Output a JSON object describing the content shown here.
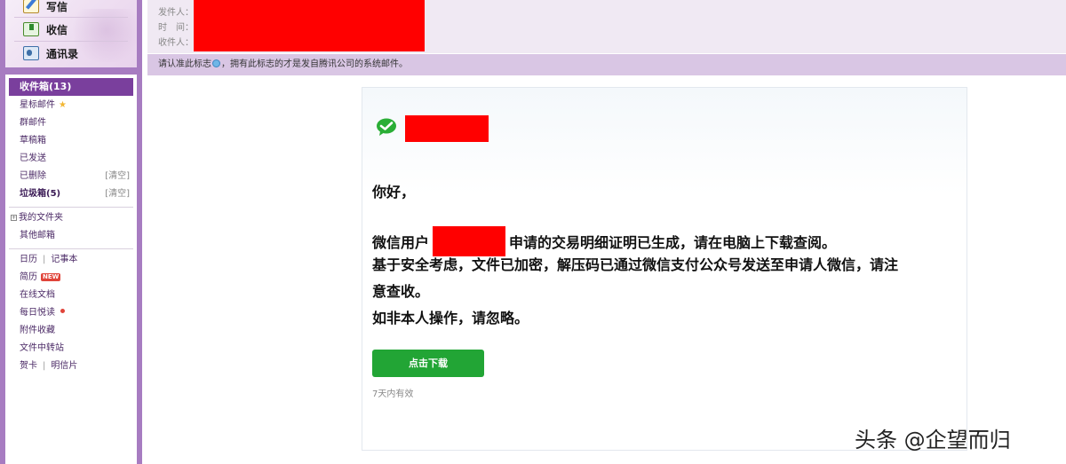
{
  "sidebar": {
    "quick_actions": [
      {
        "label": "写信",
        "icon": "compose-icon"
      },
      {
        "label": "收信",
        "icon": "receive-icon"
      },
      {
        "label": "通讯录",
        "icon": "contacts-icon"
      }
    ],
    "inbox_label": "收件箱(13)",
    "items": {
      "starred": "星标邮件",
      "group": "群邮件",
      "drafts": "草稿箱",
      "sent": "已发送",
      "deleted": "已删除",
      "deleted_action": "[清空]",
      "spam": "垃圾箱(5)",
      "spam_action": "[清空]",
      "my_folders": "我的文件夹",
      "other_mailbox": "其他邮箱",
      "calendar": "日历",
      "notebook": "记事本",
      "resume": "简历",
      "resume_badge": "NEW",
      "online_docs": "在线文档",
      "daily_read": "每日悦读",
      "attachments": "附件收藏",
      "file_transfer": "文件中转站",
      "greeting_card": "贺卡",
      "postcard": "明信片"
    }
  },
  "header": {
    "from_label": "发件人：",
    "time_label": "时　间：",
    "to_label": "收件人：",
    "notice_prefix": "请认准此标志",
    "notice_suffix": "，拥有此标志的才是发自腾讯公司的系统邮件。"
  },
  "email": {
    "greeting": "你好，",
    "line1_prefix": "微信用户",
    "line1_suffix": "申请的交易明细证明已生成，请在电脑上下载查阅。",
    "line2": "基于安全考虑，文件已加密，解压码已通过微信支付公众号发送至申请人微信，请注",
    "line3": "意查收。",
    "line4": "如非本人操作，请忽略。",
    "button_label": "点击下载",
    "validity": "7天内有效"
  },
  "watermark": "头条 @企望而归",
  "colors": {
    "sidebar_bg": "#a77cc1",
    "active_bg": "#7a3f9d",
    "header_bg": "#f0e9f3",
    "notice_bg": "#d9c6e4",
    "button_green": "#22a535",
    "wechat_green": "#2aae36",
    "redaction": "#ff0000"
  }
}
